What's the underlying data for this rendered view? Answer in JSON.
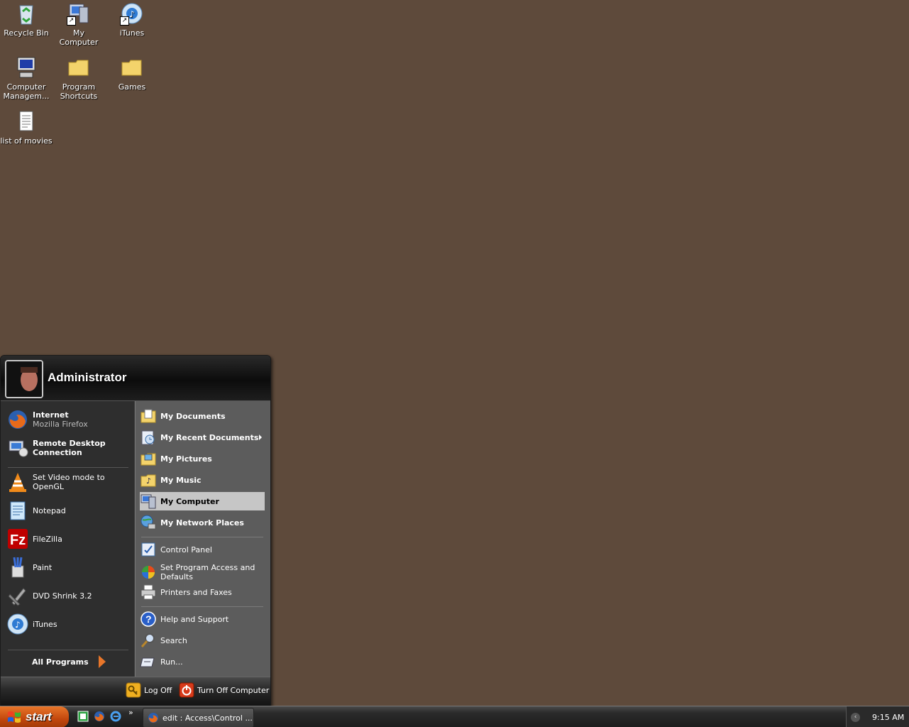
{
  "desktop": {
    "icons": [
      {
        "label": "Recycle Bin",
        "icon": "recycle-bin-icon"
      },
      {
        "label": "My Computer",
        "icon": "my-computer-icon"
      },
      {
        "label": "iTunes",
        "icon": "itunes-icon"
      },
      {
        "label": "Computer\nManagem...",
        "icon": "computer-management-icon"
      },
      {
        "label": "Program\nShortcuts",
        "icon": "folder-icon"
      },
      {
        "label": "Games",
        "icon": "folder-icon"
      },
      {
        "label": "list of movies",
        "icon": "text-document-icon"
      }
    ],
    "background_color": "#5e4a3b"
  },
  "start_menu": {
    "username": "Administrator",
    "pinned": [
      {
        "title": "Internet",
        "subtitle": "Mozilla Firefox",
        "icon": "firefox-icon"
      },
      {
        "title": "Remote Desktop\nConnection",
        "icon": "remote-desktop-icon"
      }
    ],
    "recent": [
      {
        "label": "Set Video mode to OpenGL",
        "icon": "vlc-cone-icon"
      },
      {
        "label": "Notepad",
        "icon": "notepad-icon"
      },
      {
        "label": "FileZilla",
        "icon": "filezilla-icon"
      },
      {
        "label": "Paint",
        "icon": "paint-icon"
      },
      {
        "label": "DVD Shrink 3.2",
        "icon": "dvd-shrink-icon"
      },
      {
        "label": "iTunes",
        "icon": "itunes-icon"
      }
    ],
    "all_programs": "All Programs",
    "places": [
      {
        "label": "My Documents",
        "icon": "my-documents-icon"
      },
      {
        "label": "My Recent Documents",
        "icon": "recent-documents-icon"
      },
      {
        "label": "My Pictures",
        "icon": "my-pictures-icon"
      },
      {
        "label": "My Music",
        "icon": "my-music-icon"
      },
      {
        "label": "My Computer",
        "icon": "my-computer-icon",
        "highlighted": true
      },
      {
        "label": "My Network Places",
        "icon": "network-places-icon"
      }
    ],
    "settings": [
      {
        "label": "Control Panel",
        "icon": "control-panel-icon"
      },
      {
        "label": "Set Program Access and\nDefaults",
        "icon": "program-access-icon"
      },
      {
        "label": "Printers and Faxes",
        "icon": "printer-icon"
      }
    ],
    "tools": [
      {
        "label": "Help and Support",
        "icon": "help-icon"
      },
      {
        "label": "Search",
        "icon": "search-icon"
      },
      {
        "label": "Run...",
        "icon": "run-icon"
      }
    ],
    "log_off": "Log Off",
    "turn_off": "Turn Off Computer"
  },
  "taskbar": {
    "start_label": "start",
    "quick_launch": [
      "green-app-icon",
      "firefox-icon",
      "ie-icon"
    ],
    "more_label": "»",
    "task_label": "edit : Access\\Control ...",
    "clock": "9:15 AM",
    "accent": "#e8762a"
  }
}
